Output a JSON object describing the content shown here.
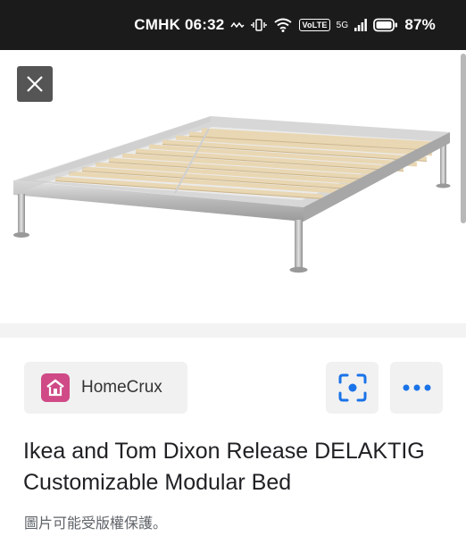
{
  "status_bar": {
    "carrier_time": "CMHK 06:32",
    "volte": "VoLTE",
    "network": "5G",
    "battery": "87%"
  },
  "viewer": {
    "close_icon": "close-icon",
    "image_alt": "DELAKTIG bed frame with wooden slats"
  },
  "source": {
    "name": "HomeCrux",
    "icon": "house-icon",
    "icon_color": "#cf4a86"
  },
  "actions": {
    "lens_icon": "lens-search-icon",
    "more_icon": "more-dots-icon",
    "accent": "#1a73e8"
  },
  "result": {
    "title": "Ikea and Tom Dixon Release DELAKTIG Customizable Modular Bed",
    "copyright_note": "圖片可能受版權保護。"
  }
}
